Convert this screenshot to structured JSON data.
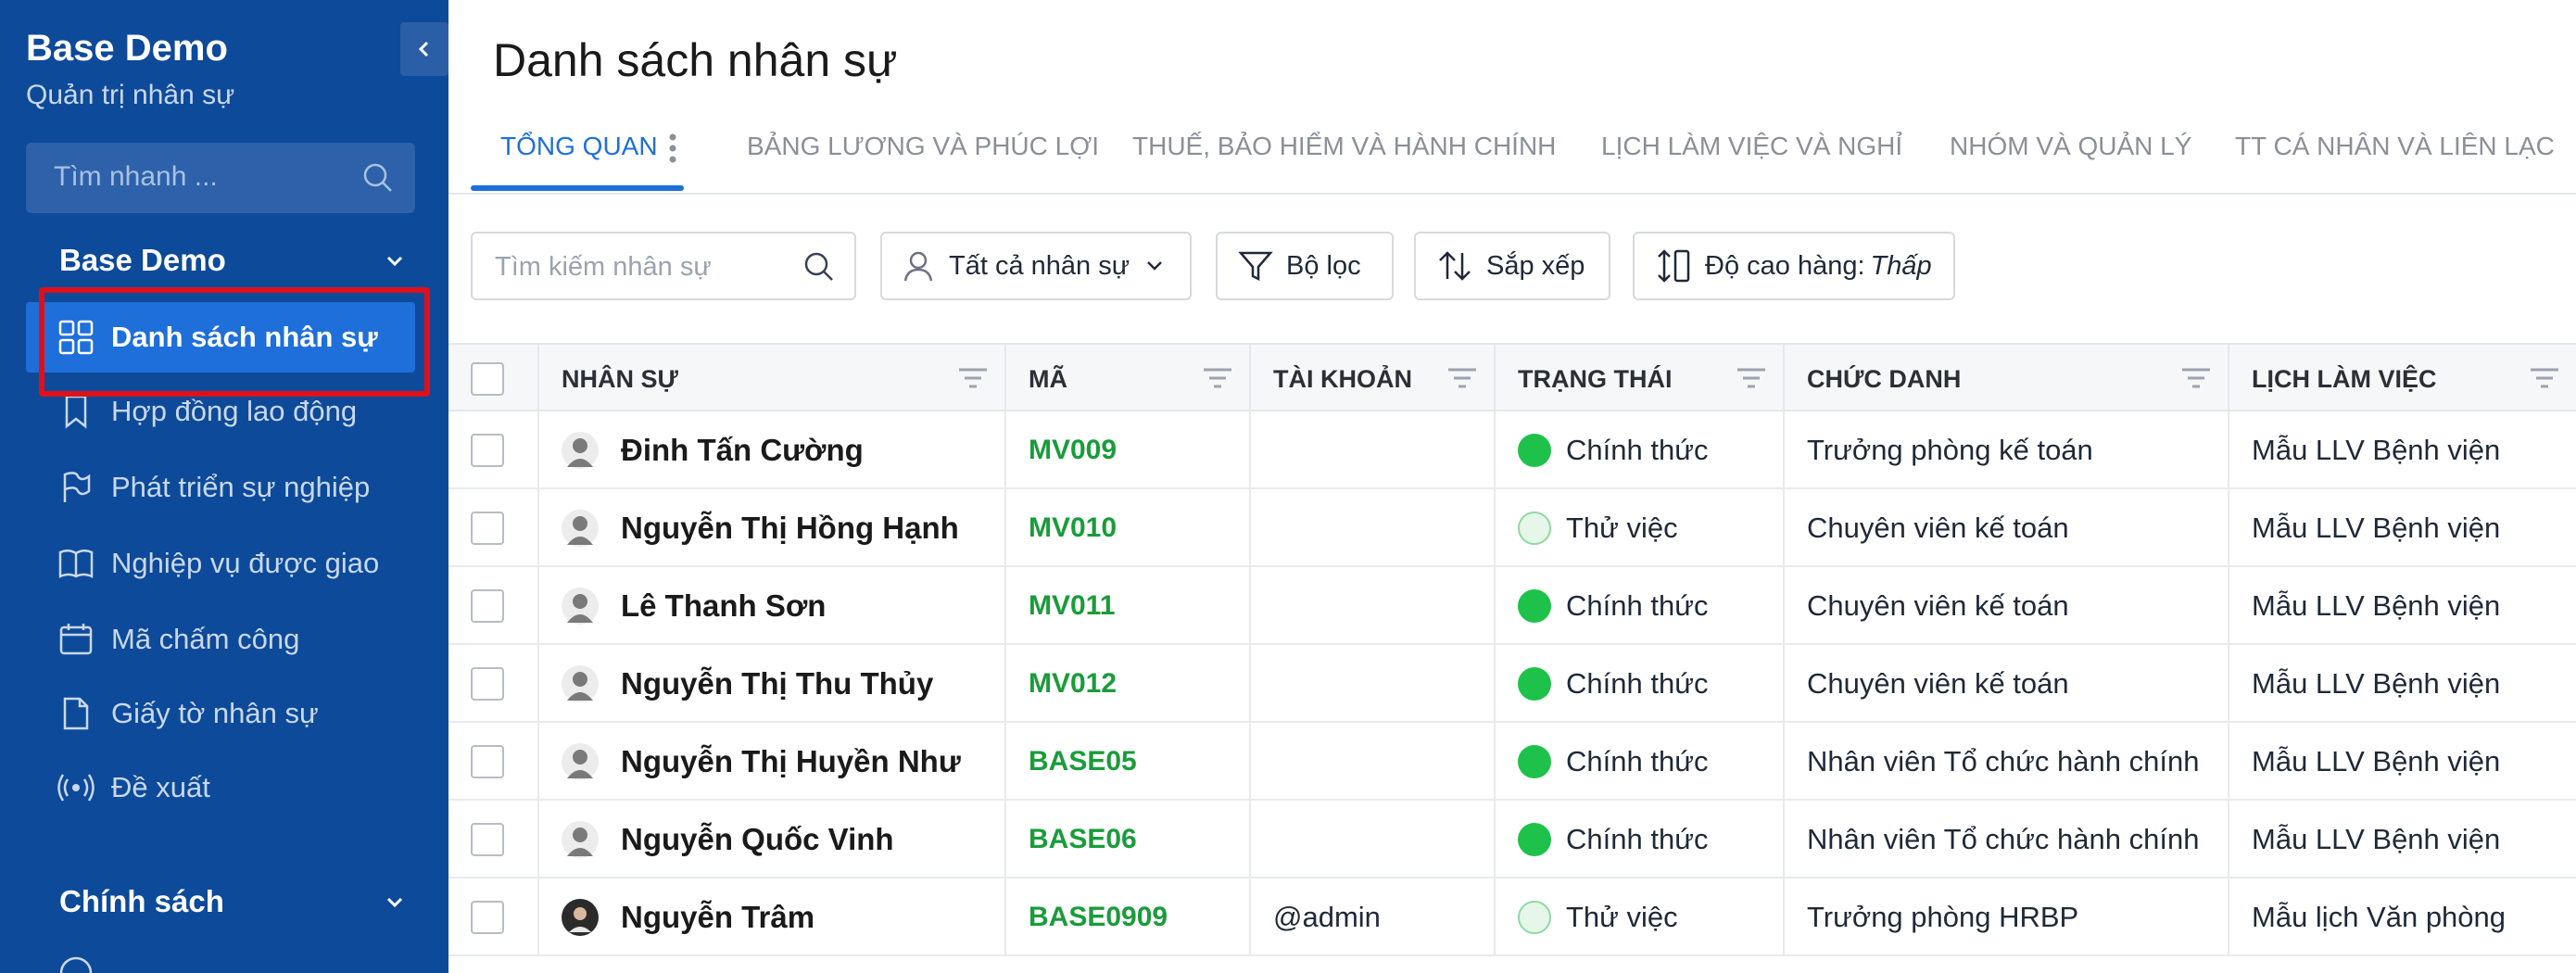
{
  "sidebar": {
    "brand_title": "Base Demo",
    "brand_subtitle": "Quản trị nhân sự",
    "search_placeholder": "Tìm nhanh ...",
    "section1_title": "Base Demo",
    "items": [
      {
        "label": "Danh sách nhân sự",
        "icon": "grid-icon",
        "active": true
      },
      {
        "label": "Hợp đồng lao động",
        "icon": "bookmark-icon",
        "active": false
      },
      {
        "label": "Phát triển sự nghiệp",
        "icon": "flag-icon",
        "active": false
      },
      {
        "label": "Nghiệp vụ được giao",
        "icon": "book-icon",
        "active": false
      },
      {
        "label": "Mã chấm công",
        "icon": "calendar-icon",
        "active": false
      },
      {
        "label": "Giấy tờ nhân sự",
        "icon": "document-icon",
        "active": false
      },
      {
        "label": "Đề xuất",
        "icon": "broadcast-icon",
        "active": false
      }
    ],
    "section2_title": "Chính sách"
  },
  "main": {
    "title": "Danh sách nhân sự",
    "tabs": [
      {
        "label": "TỔNG QUAN",
        "active": true
      },
      {
        "label": "BẢNG LƯƠNG VÀ PHÚC LỢI"
      },
      {
        "label": "THUẾ, BẢO HIỂM VÀ HÀNH CHÍNH"
      },
      {
        "label": "LỊCH LÀM VIỆC VÀ NGHỈ"
      },
      {
        "label": "NHÓM VÀ QUẢN LÝ"
      },
      {
        "label": "TT CÁ NHÂN VÀ LIÊN LẠC"
      }
    ],
    "toolbar": {
      "search_placeholder": "Tìm kiếm nhân sự",
      "all_staff": "Tất cả nhân sự",
      "filter": "Bộ lọc",
      "sort": "Sắp xếp",
      "row_height_label": "Độ cao hàng: ",
      "row_height_value": "Thấp"
    },
    "columns": [
      "NHÂN SỰ",
      "MÃ",
      "TÀI KHOẢN",
      "TRẠNG THÁI",
      "CHỨC DANH",
      "LỊCH LÀM VIỆC"
    ],
    "rows": [
      {
        "name": "Đinh Tấn Cường",
        "code": "MV009",
        "account": "",
        "status": "Chính thức",
        "status_type": "full",
        "title": "Trưởng phòng kế toán",
        "schedule": "Mẫu LLV Bệnh viện",
        "avatar": "placeholder"
      },
      {
        "name": "Nguyễn Thị Hồng Hạnh",
        "code": "MV010",
        "account": "",
        "status": "Thử việc",
        "status_type": "trial",
        "title": "Chuyên viên kế toán",
        "schedule": "Mẫu LLV Bệnh viện",
        "avatar": "placeholder"
      },
      {
        "name": "Lê Thanh Sơn",
        "code": "MV011",
        "account": "",
        "status": "Chính thức",
        "status_type": "full",
        "title": "Chuyên viên kế toán",
        "schedule": "Mẫu LLV Bệnh viện",
        "avatar": "placeholder"
      },
      {
        "name": "Nguyễn Thị Thu Thủy",
        "code": "MV012",
        "account": "",
        "status": "Chính thức",
        "status_type": "full",
        "title": "Chuyên viên kế toán",
        "schedule": "Mẫu LLV Bệnh viện",
        "avatar": "placeholder"
      },
      {
        "name": "Nguyễn Thị Huyền Như",
        "code": "BASE05",
        "account": "",
        "status": "Chính thức",
        "status_type": "full",
        "title": "Nhân viên Tổ chức hành chính",
        "schedule": "Mẫu LLV Bệnh viện",
        "avatar": "placeholder"
      },
      {
        "name": "Nguyễn Quốc Vinh",
        "code": "BASE06",
        "account": "",
        "status": "Chính thức",
        "status_type": "full",
        "title": "Nhân viên Tổ chức hành chính",
        "schedule": "Mẫu LLV Bệnh viện",
        "avatar": "placeholder"
      },
      {
        "name": "Nguyễn Trâm",
        "code": "BASE0909",
        "account": "@admin",
        "status": "Thử việc",
        "status_type": "trial",
        "title": "Trưởng phòng HRBP",
        "schedule": "Mẫu lịch Văn phòng",
        "avatar": "photo"
      }
    ]
  },
  "colors": {
    "sidebar_bg": "#0d4a99",
    "accent": "#1e6fd9",
    "code_green": "#1a9c3a",
    "status_full": "#1ec24a",
    "highlight_red": "#e0101a"
  }
}
